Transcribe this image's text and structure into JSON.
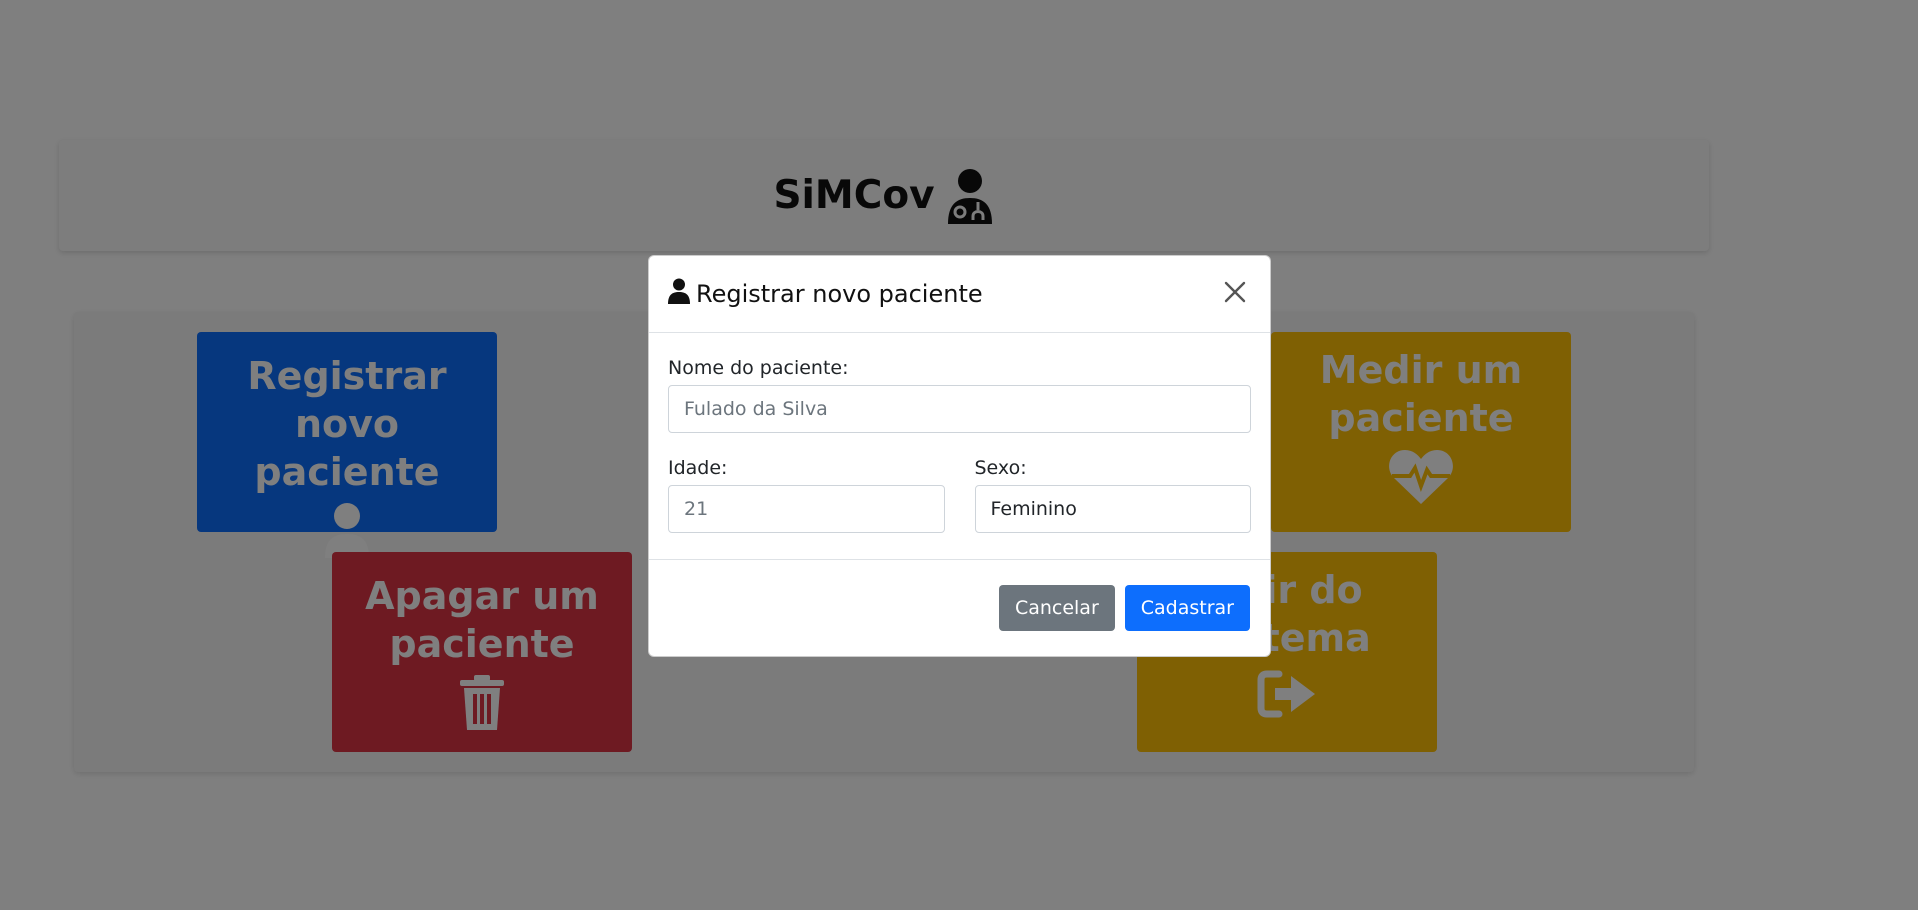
{
  "app": {
    "title": "SiMCov",
    "logo_icon": "user-doctor-icon"
  },
  "menu": {
    "tiles": [
      {
        "label": "Registrar novo\npaciente",
        "icon": "user-icon",
        "color": "#0d6efd"
      },
      {
        "label": "Apagar um\npaciente",
        "icon": "trash-icon",
        "color": "#dc3545"
      },
      {
        "label": "Medir um\npaciente",
        "icon": "heart-pulse-icon",
        "color": "#ffc107"
      },
      {
        "label": "Sair do\nsistema",
        "icon": "sign-out-icon",
        "color": "#ffc107"
      }
    ]
  },
  "modal": {
    "title": "Registrar novo paciente",
    "title_icon": "user-icon",
    "close_icon": "close-icon",
    "fields": {
      "name": {
        "label": "Nome do paciente:",
        "placeholder": "Fulado da Silva",
        "value": ""
      },
      "age": {
        "label": "Idade:",
        "placeholder": "21",
        "value": ""
      },
      "sex": {
        "label": "Sexo:",
        "value": "Feminino"
      }
    },
    "buttons": {
      "cancel": "Cancelar",
      "submit": "Cadastrar"
    }
  },
  "colors": {
    "primary": "#0d6efd",
    "secondary": "#6c757d",
    "danger": "#dc3545",
    "warning": "#ffc107"
  }
}
